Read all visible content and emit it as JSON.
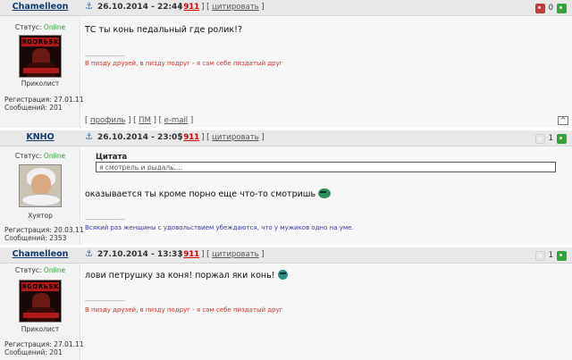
{
  "posts": [
    {
      "author": "Chamelleon",
      "date": "26.10.2014 - 22:44",
      "post_number": "911",
      "quote_label": "цитировать",
      "rating_value": "0",
      "status_label": "Статус:",
      "status_value": "Online",
      "rank": "Приколист",
      "avatar_text": "ЯGORЬSK",
      "registration": "Регистрация: 27.01.11",
      "messages": "Сообщений: 201",
      "text": "ТС ты конь педальный где ролик!?",
      "separator": "--------------------",
      "signature": "В пизду друзей, в пизду подруг - я сам себе пиздатый друг",
      "footer": {
        "profile": "профиль",
        "pm": "ПМ",
        "email": "e-mail",
        "up": "^"
      }
    },
    {
      "author": "KNHO",
      "date": "26.10.2014 - 23:05",
      "post_number": "911",
      "quote_label": "цитировать",
      "rating_value": "1",
      "status_label": "Статус:",
      "status_value": "Online",
      "rank": "Хуятор",
      "registration": "Регистрация: 20.03.11",
      "messages": "Сообщений: 2353",
      "quote_title": "Цитата",
      "quote_text": "я смотрель и рыдаль....",
      "text": "оказывается ты кроме порно еще что-то смотришь",
      "separator": "--------------------",
      "signature": "Всякий раз женщины с удовольствием убеждаются, что у мужиков одно на уме."
    },
    {
      "author": "Chamelleon",
      "date": "27.10.2014 - 13:33",
      "post_number": "911",
      "quote_label": "цитировать",
      "rating_value": "1",
      "status_label": "Статус:",
      "status_value": "Online",
      "rank": "Приколист",
      "avatar_text": "ЯGORЬSK",
      "registration": "Регистрация: 27.01.11",
      "messages": "Сообщений: 201",
      "text": "лови петрушку за коня! поржал яки конь!",
      "separator": "--------------------",
      "signature": "В пизду друзей, в пизду подруг - я сам себе пиздатый друг"
    }
  ],
  "colors": {
    "online": "#2fa53b",
    "post_number": "#cc0000",
    "signature_red": "#d43030",
    "signature_blue": "#3a3aa0",
    "author": "#103b6e"
  }
}
